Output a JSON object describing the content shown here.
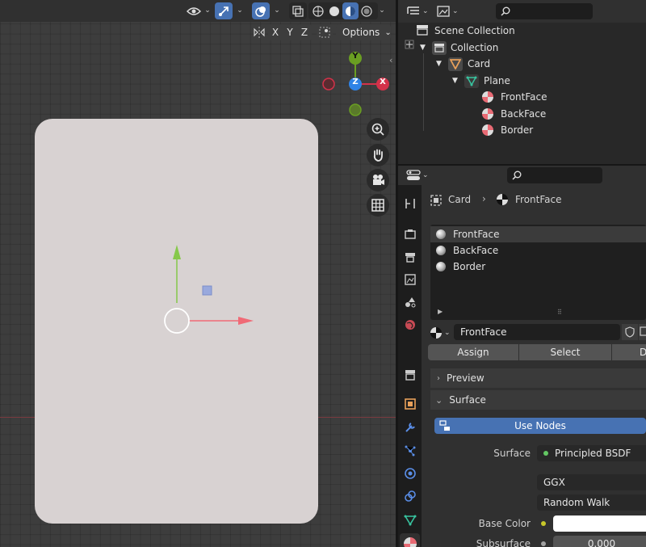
{
  "viewport": {
    "axis_buttons": [
      "X",
      "Y",
      "Z"
    ],
    "options_label": "Options",
    "gizmo": {
      "y": "Y",
      "z": "Z",
      "x": "X"
    }
  },
  "outliner": {
    "rows": [
      {
        "label": "Scene Collection"
      },
      {
        "label": "Collection"
      },
      {
        "label": "Card"
      },
      {
        "label": "Plane"
      },
      {
        "label": "FrontFace"
      },
      {
        "label": "BackFace"
      },
      {
        "label": "Border"
      }
    ]
  },
  "properties": {
    "breadcrumb": {
      "object": "Card",
      "material": "FrontFace"
    },
    "materials": [
      "FrontFace",
      "BackFace",
      "Border"
    ],
    "material_name": "FrontFace",
    "buttons": {
      "assign": "Assign",
      "select": "Select",
      "deselect_partial": "D"
    },
    "panels": {
      "preview": "Preview",
      "surface": "Surface"
    },
    "use_nodes_label": "Use Nodes",
    "surface_label": "Surface",
    "surface_value": "Principled BSDF",
    "distribution": "GGX",
    "subsurface_method": "Random Walk",
    "base_color_label": "Base Color",
    "subsurface_label": "Subsurface",
    "subsurface_value": "0.000"
  },
  "colors": {
    "accent": "#4772b3",
    "axis_x": "#d4324a",
    "axis_y": "#6a9e22",
    "axis_z": "#2f83e6",
    "card": "#d8d2d2"
  }
}
